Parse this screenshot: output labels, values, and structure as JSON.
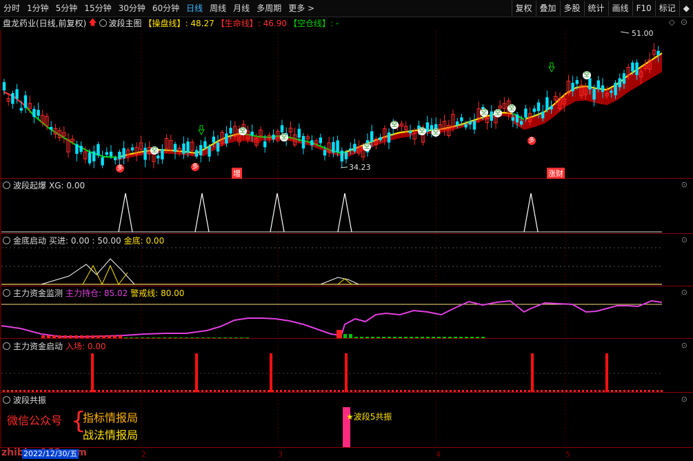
{
  "toolbar": {
    "timeframes": [
      "分时",
      "1分钟",
      "5分钟",
      "15分钟",
      "30分钟",
      "60分钟",
      "日线",
      "周线",
      "月线",
      "多周期",
      "更多 >"
    ],
    "active_index": 6,
    "right_buttons": [
      "复权",
      "叠加",
      "多股",
      "统计",
      "画线",
      "F10",
      "标记",
      "◆"
    ]
  },
  "infobar": {
    "stock": "盘龙药业(日线,前复权)",
    "indicator": "波段主图",
    "cao_label": "【操盘线】",
    "cao_value": ": 48.27",
    "life_label": "【生命线】",
    "life_value": ": 46.90",
    "empty_label": "【空仓线】",
    "empty_value": ": -"
  },
  "main_chart": {
    "high_label": "51.00",
    "low_label": "34.23",
    "tag_zeng": "增",
    "tag_zhangcai": "涨财",
    "kong": "空",
    "duo": "多"
  },
  "panes": {
    "p1": {
      "title": "波段起爆",
      "vals": "XG: 0.00"
    },
    "p2": {
      "title": "金底启动",
      "vals": "买进: 0.00 : 50.00",
      "gold": "金底: 0.00"
    },
    "p3": {
      "title": "主力资金监测",
      "hold": "主力持仓: 85.02",
      "warn": "警戒线: 80.00"
    },
    "p4": {
      "title": "主力资金启动",
      "enter": "入场: 0.00"
    },
    "p5": {
      "title": "波段共振",
      "signal": "波段5共振"
    }
  },
  "promo": {
    "wechat": "微信公众号",
    "line1": "指标情报局",
    "line2": "战法情报局",
    "watermark": "zhibiao168.com"
  },
  "axis": {
    "date_box": "2022/12/30/五",
    "months": [
      "2",
      "3",
      "4",
      "5"
    ]
  },
  "colors": {
    "up": "#ff2a2a",
    "down": "#00e0ff",
    "cao": "#ffe000",
    "life": "#ff3030",
    "empty": "#00d000",
    "hold": "#e040e0"
  }
}
